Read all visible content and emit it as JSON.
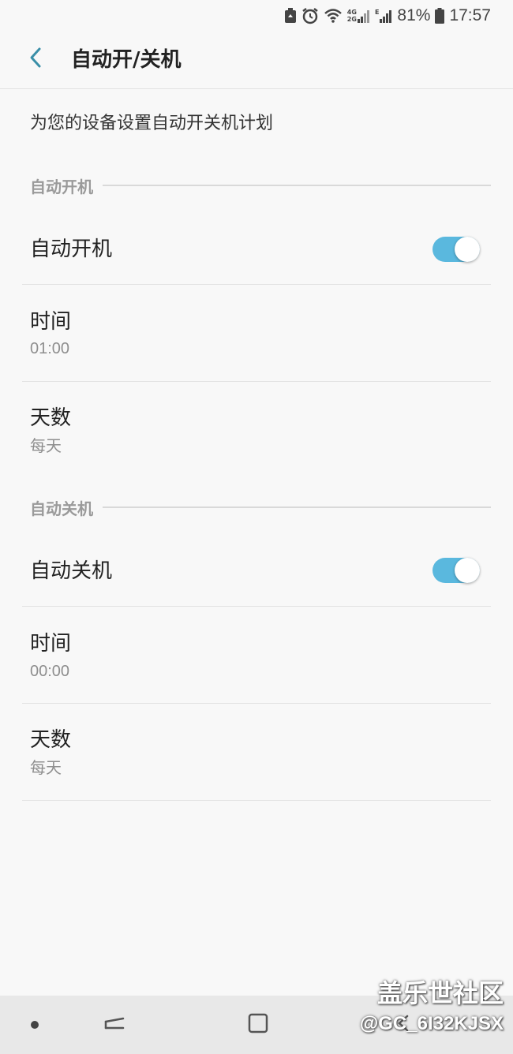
{
  "status_bar": {
    "battery_percent": "81%",
    "time": "17:57",
    "network_4g": "4G",
    "network_2g": "2G",
    "network_e": "E"
  },
  "header": {
    "title": "自动开/关机"
  },
  "description": "为您的设备设置自动开关机计划",
  "sections": [
    {
      "header": "自动开机",
      "toggle_label": "自动开机",
      "toggle_on": true,
      "time_label": "时间",
      "time_value": "01:00",
      "days_label": "天数",
      "days_value": "每天"
    },
    {
      "header": "自动关机",
      "toggle_label": "自动关机",
      "toggle_on": true,
      "time_label": "时间",
      "time_value": "00:00",
      "days_label": "天数",
      "days_value": "每天"
    }
  ],
  "colors": {
    "accent": "#5ab8de",
    "back_arrow": "#3a8fa8"
  },
  "watermark": {
    "title": "盖乐世社区",
    "id": "@GC_6I32KJSX"
  }
}
